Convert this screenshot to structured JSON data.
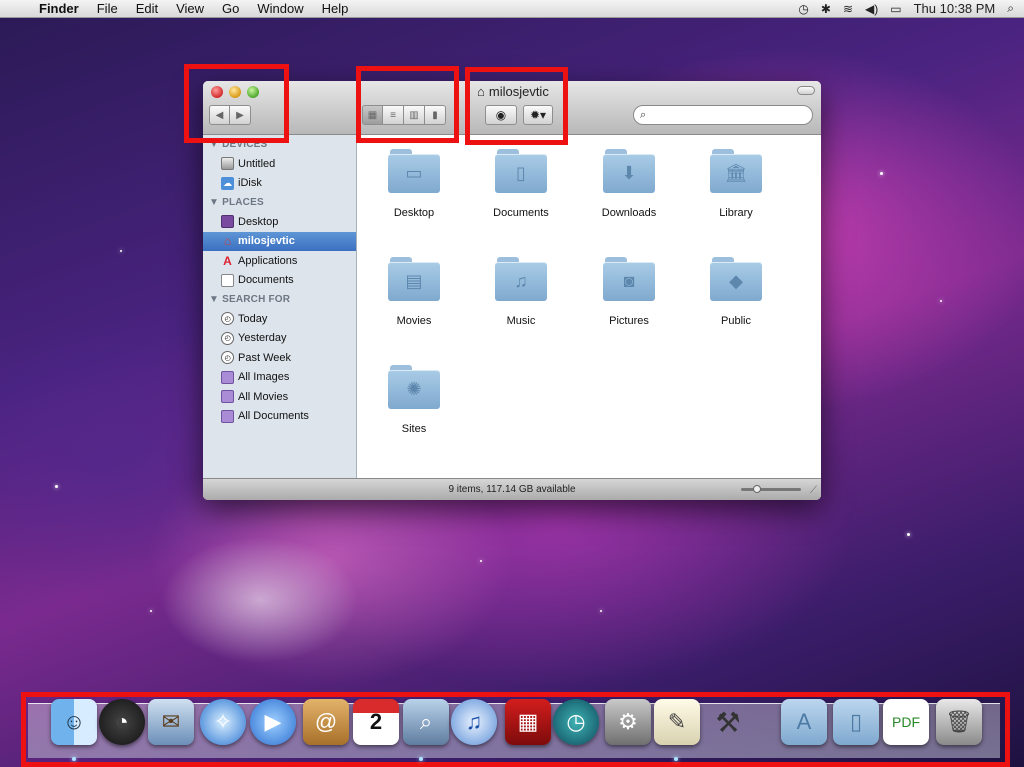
{
  "menubar": {
    "app_name": "Finder",
    "menus": [
      "File",
      "Edit",
      "View",
      "Go",
      "Window",
      "Help"
    ],
    "clock": "Thu 10:38 PM"
  },
  "window": {
    "title": "milosjevtic",
    "status": "9 items, 117.14 GB available"
  },
  "sidebar": {
    "devices_header": "DEVICES",
    "devices": [
      "Untitled",
      "iDisk"
    ],
    "places_header": "PLACES",
    "places": [
      "Desktop",
      "milosjevtic",
      "Applications",
      "Documents"
    ],
    "search_header": "SEARCH FOR",
    "search": [
      "Today",
      "Yesterday",
      "Past Week",
      "All Images",
      "All Movies",
      "All Documents"
    ]
  },
  "items": [
    "Desktop",
    "Documents",
    "Downloads",
    "Library",
    "Movies",
    "Music",
    "Pictures",
    "Public",
    "Sites"
  ],
  "colors": {
    "highlight": "#ee1111",
    "selection": "#3a70c0",
    "folder": "#8fb7da"
  }
}
